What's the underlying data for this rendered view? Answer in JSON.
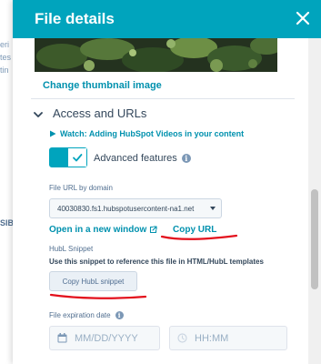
{
  "background_page": {
    "fragments": [
      "eri",
      "tes",
      "tin",
      "SIB"
    ]
  },
  "panel": {
    "title": "File details",
    "close_icon": "close-icon",
    "header_color": "#00a4bd"
  },
  "thumbnail": {
    "change_label": "Change thumbnail image"
  },
  "access_section": {
    "heading": "Access and URLs",
    "watch_link": "Watch: Adding HubSpot Videos in your content",
    "advanced_features_label": "Advanced features",
    "advanced_features_enabled": true,
    "file_url_label": "File URL by domain",
    "domain_selected": "40030830.fs1.hubspotusercontent-na1.net",
    "open_new_window": "Open in a new window",
    "copy_url": "Copy URL",
    "hubl_label": "HubL Snippet",
    "hubl_description": "Use this snippet to reference this file in HTML/HubL templates",
    "copy_hubl_button": "Copy HubL snippet",
    "expiration_label": "File expiration date",
    "date_placeholder": "MM/DD/YYYY",
    "time_placeholder": "HH:MM"
  },
  "colors": {
    "accent": "#00a4bd",
    "link": "#0091ae",
    "annotation_red": "#e3101c"
  },
  "icons": [
    "close-icon",
    "chevron-down-icon",
    "play-icon",
    "checkmark-icon",
    "info-icon",
    "external-link-icon",
    "calendar-icon",
    "clock-icon"
  ]
}
